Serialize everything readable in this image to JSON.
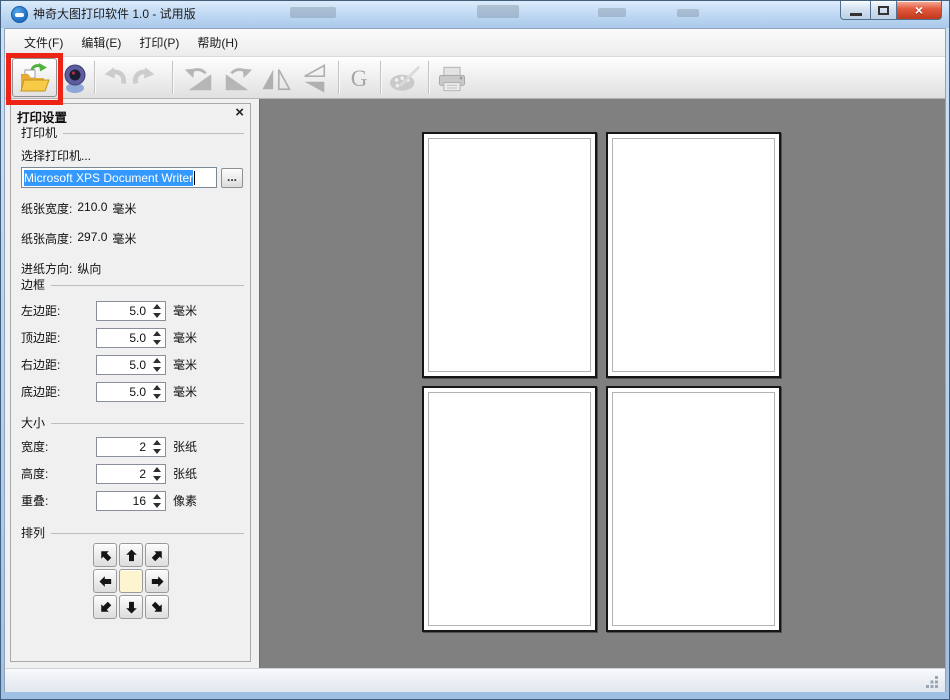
{
  "window": {
    "title": "神奇大图打印软件 1.0 - 试用版",
    "close_glyph": "×"
  },
  "menu": {
    "items": [
      {
        "label": "文件(F)"
      },
      {
        "label": "编辑(E)"
      },
      {
        "label": "打印(P)"
      },
      {
        "label": "帮助(H)"
      }
    ]
  },
  "toolbar": {
    "grayscale_label": "G",
    "icons": [
      "open-folder",
      "camera",
      "undo",
      "redo",
      "rotate-left",
      "rotate-right",
      "flip-horizontal",
      "flip-vertical",
      "grayscale",
      "palette",
      "printer"
    ]
  },
  "panel": {
    "title": "打印设置",
    "close_glyph": "×",
    "printer_group": {
      "legend": "打印机",
      "select_printer_label": "选择打印机...",
      "printer_name": "Microsoft XPS Document Writer",
      "browse_label": "...",
      "paper_width": {
        "label": "纸张宽度:",
        "value": "210.0",
        "unit": "毫米"
      },
      "paper_height": {
        "label": "纸张高度:",
        "value": "297.0",
        "unit": "毫米"
      },
      "feed_direction": {
        "label": "进纸方向:",
        "value": "纵向"
      }
    },
    "margin_group": {
      "legend": "边框",
      "rows": [
        {
          "label": "左边距:",
          "value": "5.0",
          "unit": "毫米"
        },
        {
          "label": "顶边距:",
          "value": "5.0",
          "unit": "毫米"
        },
        {
          "label": "右边距:",
          "value": "5.0",
          "unit": "毫米"
        },
        {
          "label": "底边距:",
          "value": "5.0",
          "unit": "毫米"
        }
      ]
    },
    "size_group": {
      "legend": "大小",
      "rows": [
        {
          "label": "宽度:",
          "value": "2",
          "unit": "张纸"
        },
        {
          "label": "高度:",
          "value": "2",
          "unit": "张纸"
        },
        {
          "label": "重叠:",
          "value": "16",
          "unit": "像素"
        }
      ]
    },
    "arrange_group": {
      "legend": "排列",
      "arrows": [
        "up-left",
        "up",
        "up-right",
        "left",
        "center",
        "right",
        "down-left",
        "down",
        "down-right"
      ]
    }
  },
  "canvas": {
    "preview_grid": {
      "rows": 2,
      "cols": 2
    }
  },
  "annotation": {
    "type": "highlight-box",
    "target": "open-button",
    "color": "#ed2315"
  },
  "colors": {
    "titlebar": "#bdd7f3",
    "selection_blue": "#3399fe",
    "canvas_background": "#808080",
    "page": "#ffffff",
    "arrange_center": "#fdf5d0",
    "folder_yellow": "#f2c233",
    "highlight_red": "#ed2315"
  }
}
